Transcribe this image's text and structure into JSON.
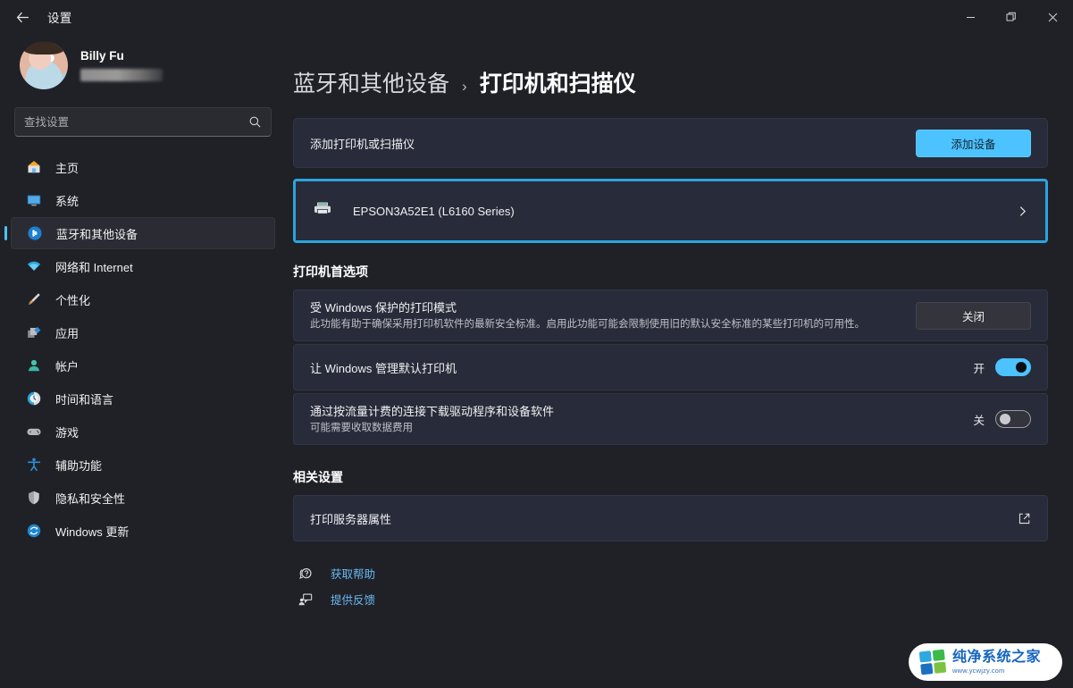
{
  "titlebar": {
    "app_title": "设置",
    "back_icon": "back-arrow-icon",
    "minimize_label": "—",
    "maximize_label": "❐",
    "close_label": "✕"
  },
  "sidebar": {
    "profile": {
      "name": "Billy Fu",
      "email_masked": ""
    },
    "search": {
      "placeholder": "查找设置",
      "value": "",
      "icon": "search-icon"
    },
    "items": [
      {
        "label": "主页",
        "icon": "home-icon",
        "active": false
      },
      {
        "label": "系统",
        "icon": "system-icon",
        "active": false
      },
      {
        "label": "蓝牙和其他设备",
        "icon": "bluetooth-icon",
        "active": true
      },
      {
        "label": "网络和 Internet",
        "icon": "wifi-icon",
        "active": false
      },
      {
        "label": "个性化",
        "icon": "brush-icon",
        "active": false
      },
      {
        "label": "应用",
        "icon": "apps-icon",
        "active": false
      },
      {
        "label": "帐户",
        "icon": "account-icon",
        "active": false
      },
      {
        "label": "时间和语言",
        "icon": "clock-icon",
        "active": false
      },
      {
        "label": "游戏",
        "icon": "gamepad-icon",
        "active": false
      },
      {
        "label": "辅助功能",
        "icon": "accessibility-icon",
        "active": false
      },
      {
        "label": "隐私和安全性",
        "icon": "shield-icon",
        "active": false
      },
      {
        "label": "Windows 更新",
        "icon": "update-icon",
        "active": false
      }
    ]
  },
  "main": {
    "breadcrumb": {
      "parent": "蓝牙和其他设备",
      "separator": "›",
      "current": "打印机和扫描仪"
    },
    "add_row": {
      "label": "添加打印机或扫描仪",
      "button": "添加设备"
    },
    "printer": {
      "name": "EPSON3A52E1 (L6160 Series)",
      "icon": "printer-icon",
      "chevron": "chevron-right-icon",
      "highlighted": true
    },
    "preferences": {
      "title": "打印机首选项",
      "protected_mode": {
        "label": "受 Windows 保护的打印模式",
        "description": "此功能有助于确保采用打印机软件的最新安全标准。启用此功能可能会限制使用旧的默认安全标准的某些打印机的可用性。",
        "button": "关闭"
      },
      "manage_default": {
        "label": "让 Windows 管理默认打印机",
        "state": "开",
        "on": true
      },
      "metered_download": {
        "label": "通过按流量计费的连接下载驱动程序和设备软件",
        "description": "可能需要收取数据费用",
        "state": "关",
        "on": false
      }
    },
    "related": {
      "title": "相关设置",
      "print_server": {
        "label": "打印服务器属性",
        "icon": "external-link-icon"
      }
    },
    "links": [
      {
        "label": "获取帮助",
        "icon": "help-icon"
      },
      {
        "label": "提供反馈",
        "icon": "feedback-icon"
      }
    ]
  },
  "watermark": {
    "title": "纯净系统之家",
    "url": "www.ycwjzy.com"
  },
  "colors": {
    "accent": "#4cc2ff",
    "highlight": "#2ba4dd",
    "card": "#282c3a",
    "page": "#202127",
    "link": "#69b8f2"
  }
}
